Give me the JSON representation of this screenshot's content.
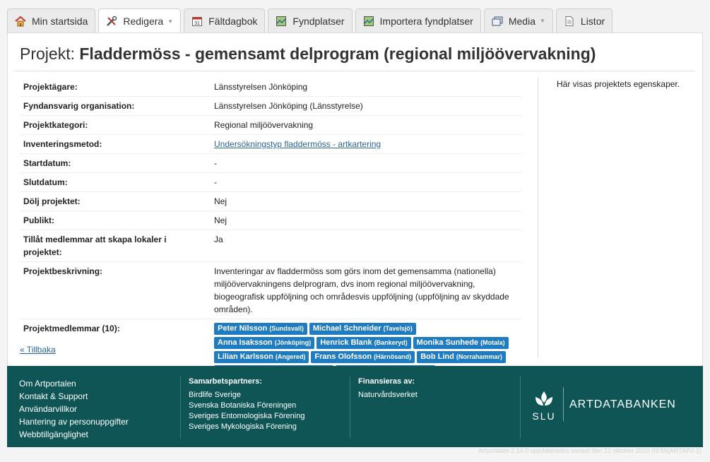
{
  "tabs": [
    {
      "label": "Min startsida",
      "icon": "home-icon"
    },
    {
      "label": "Redigera",
      "icon": "tools-icon",
      "dropdown": true,
      "active": true
    },
    {
      "label": "Fältdagbok",
      "icon": "calendar-icon"
    },
    {
      "label": "Fyndplatser",
      "icon": "map-icon"
    },
    {
      "label": "Importera fyndplatser",
      "icon": "map-icon"
    },
    {
      "label": "Media",
      "icon": "media-icon",
      "dropdown": true
    },
    {
      "label": "Listor",
      "icon": "document-icon"
    }
  ],
  "title": {
    "prefix": "Projekt:",
    "name": "Fladdermöss - gemensamt delprogram (regional miljöövervakning)"
  },
  "props": {
    "owner": {
      "label": "Projektägare:",
      "value": "Länsstyrelsen Jönköping"
    },
    "org": {
      "label": "Fyndansvarig organisation:",
      "value": "Länsstyrelsen Jönköping (Länsstyrelse)"
    },
    "category": {
      "label": "Projektkategori:",
      "value": "Regional miljöövervakning"
    },
    "method": {
      "label": "Inventeringsmetod:",
      "value": "Undersökningstyp fladdermöss - artkartering"
    },
    "start": {
      "label": "Startdatum:",
      "value": "-"
    },
    "end": {
      "label": "Slutdatum:",
      "value": "-"
    },
    "hide": {
      "label": "Dölj projektet:",
      "value": "Nej"
    },
    "public": {
      "label": "Publikt:",
      "value": "Nej"
    },
    "allow": {
      "label": "Tillåt medlemmar att skapa lokaler i projektet:",
      "value": "Ja"
    },
    "desc": {
      "label": "Projektbeskrivning:",
      "value": "Inventeringar av fladdermöss som görs inom det gemensamma (nationella) miljöövervakningens delprogram, dvs inom regional miljöövervakning, biogeografisk uppföljning och områdesvis uppföljning (uppföljning av skyddade områden)."
    },
    "members_label": "Projektmedlemmar (10):"
  },
  "members": [
    {
      "name": "Peter Nilsson",
      "place": "(Sundsvall)"
    },
    {
      "name": "Michael Schneider",
      "place": "(Tavelsjö)"
    },
    {
      "name": "Anna Isaksson",
      "place": "(Jönköping)"
    },
    {
      "name": "Henrick Blank",
      "place": "(Bankeryd)"
    },
    {
      "name": "Monika Sunhede",
      "place": "(Motala)"
    },
    {
      "name": "Lilian Karlsson",
      "place": "(Angered)"
    },
    {
      "name": "Frans Olofsson",
      "place": "(Härnösand)"
    },
    {
      "name": "Bob Lind",
      "place": "(Norrahammar)"
    },
    {
      "name": "Marielle Gustafsson",
      "place": "(Jönköping)"
    },
    {
      "name": "Erik Owusu-Ansah",
      "place": "(Umeå)"
    }
  ],
  "side_note": "Här visas projektets egenskaper.",
  "back_link": "« Tillbaka",
  "footer": {
    "links": [
      "Om Artportalen",
      "Kontakt & Support",
      "Användarvillkor",
      "Hantering av personuppgifter",
      "Webbtillgänglighet"
    ],
    "partners_heading": "Samarbetspartners:",
    "partners": [
      "Birdlife Sverige",
      "Svenska Botaniska Föreningen",
      "Sveriges Entomologiska Förening",
      "Sveriges Mykologiska Förening"
    ],
    "funded_heading": "Finansieras av:",
    "funded": [
      "Naturvårdsverket"
    ],
    "slu": "SLU",
    "brand": "ARTDATABANKEN"
  },
  "version": "Artportalen 2.14.0 uppdaterades senast den 22 oktober 2020 09:55(ARTAP2-2)",
  "colors": {
    "footer": "#0f5555",
    "badge": "#1f7cc1",
    "link": "#2a6496"
  }
}
